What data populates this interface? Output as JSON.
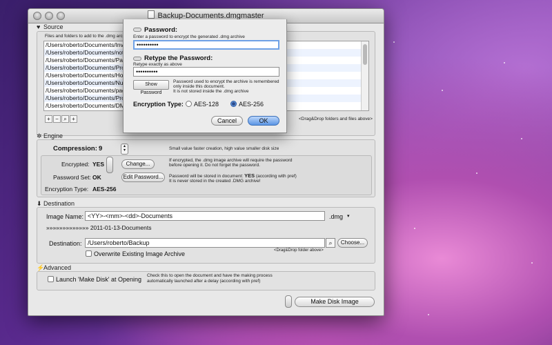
{
  "window": {
    "title": "Backup-Documents.dmgmaster"
  },
  "source": {
    "heading": "Source",
    "hint": "Files and folders to add to the .dmg archive",
    "files": [
      "/Users/roberto/Documents/Invoices",
      "/Users/roberto/Documents/notelis",
      "/Users/roberto/Documents/Passw",
      "/Users/roberto/Documents/Protect",
      "/Users/roberto/Documents/HomeF",
      "/Users/roberto/Documents/Numbe",
      "/Users/roberto/Documents/pages",
      "/Users/roberto/Documents/Produc",
      "/Users/roberto/Documents/DMG M"
    ],
    "add_label": "+",
    "remove_label": "−",
    "search_label": "🔍",
    "action_label": "+",
    "drag_hint": "<Drag&Drop folders and files above>"
  },
  "engine": {
    "heading": "Engine",
    "compression_label": "Compression:",
    "compression_value": "9",
    "compression_hint": "Small value faster creation, high value smaller disk size",
    "encrypted_label": "Encrypted:",
    "encrypted_value": "YES",
    "change_button": "Change...",
    "encrypted_hint_1": "If encrypted, the .dmg image archive will require the password",
    "encrypted_hint_2": "before opening it. Do not forget the password.",
    "password_set_label": "Password Set:",
    "password_set_value": "OK",
    "edit_password_button": "Edit Password...",
    "password_hint_1a": "Password will be stored in document:",
    "password_hint_1b": "YES",
    "password_hint_1c": "(according with pref)",
    "password_hint_2": "It is never stored in the created .DMG archive!",
    "encryption_type_label": "Encryption Type:",
    "encryption_type_value": "AES-256"
  },
  "destination": {
    "heading": "Destination",
    "image_name_label": "Image Name:",
    "image_name_value": "<YY>-<mm>-<dd>-Documents",
    "extension": ".dmg",
    "preview": "»»»»»»»»»»»»» 2011-01-13-Documents",
    "destination_label": "Destination:",
    "destination_value": "/Users/roberto/Backup",
    "choose_button": "Choose...",
    "drag_hint": "<Drag&Drop folder above>",
    "overwrite_label": "Overwrite Existing Image Archive"
  },
  "advanced": {
    "heading": "Advanced",
    "launch_label": "Launch 'Make Disk' at Opening",
    "launch_hint_1": "Check this to open the document and have the making process",
    "launch_hint_2": "automatically launched after a delay (according with pref)"
  },
  "make_disk_button": "Make Disk Image",
  "dialog": {
    "password_label": "Password:",
    "password_hint": "Enter a password to encrypt the generated .dmg archive",
    "password_value": "••••••••••",
    "retype_label": "Retype the Password:",
    "retype_hint": "Retype exactly as above",
    "retype_value": "••••••••••",
    "show_password_button": "Show Password",
    "show_hint_1": "Password used to encrypt the archive is remembered",
    "show_hint_2": "only inside this document.",
    "show_hint_3": "It is not stored inside the .dmg archive",
    "encryption_type_label": "Encryption Type:",
    "option_128": "AES-128",
    "option_256": "AES-256",
    "cancel_button": "Cancel",
    "ok_button": "OK"
  },
  "colors": {
    "accent": "#3a76cf",
    "selection": "#edf3fe"
  }
}
